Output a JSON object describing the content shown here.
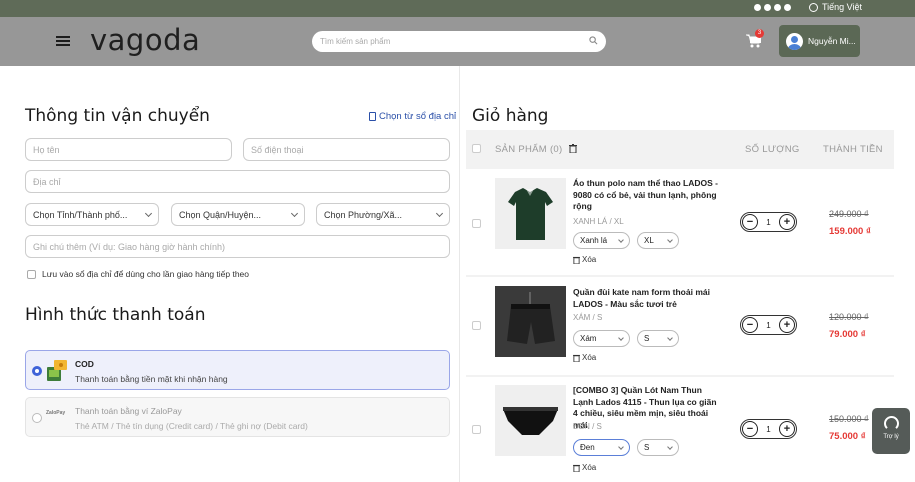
{
  "topbar": {
    "language": "Tiếng Việt",
    "social_icons": [
      "facebook-icon",
      "instagram-icon",
      "pinterest-icon",
      "youtube-icon"
    ]
  },
  "header": {
    "logo": "vagoda",
    "search_placeholder": "Tìm kiếm sản phẩm",
    "cart_count": "3",
    "user_name": "Nguyễn Mi..."
  },
  "shipping": {
    "title": "Thông tin vận chuyển",
    "address_book_link": "Chọn từ sổ địa chỉ",
    "fullname_placeholder": "Họ tên",
    "phone_placeholder": "Số điện thoại",
    "address_placeholder": "Địa chỉ",
    "province": "Chọn Tỉnh/Thành phố...",
    "district": "Chọn Quận/Huyện...",
    "ward": "Chọn Phường/Xã...",
    "note_placeholder": "Ghi chú thêm (Ví dụ: Giao hàng giờ hành chính)",
    "save_label": "Lưu vào sổ địa chỉ để dùng cho lần giao hàng tiếp theo"
  },
  "payment": {
    "title": "Hình thức thanh toán",
    "options": [
      {
        "title": "COD",
        "subtitle": "Thanh toán bằng tiền mặt khi nhận hàng",
        "selected": true
      },
      {
        "title": "Thanh toán bằng ví ZaloPay",
        "subtitle": "Thẻ ATM / Thẻ tín dụng (Credit card) / Thẻ ghi nợ (Debit card)",
        "selected": false,
        "logo_text": "ZaloPay"
      }
    ]
  },
  "cart": {
    "title": "Giỏ hàng",
    "col_product": "SẢN PHẨM (0)",
    "col_qty": "SỐ LƯỢNG",
    "col_total": "THÀNH TIỀN",
    "delete_label": "Xóa",
    "items": [
      {
        "name": "Áo thun polo nam thể thao LADOS - 9080 có cổ bẻ, vải thun lạnh, phông rộng",
        "variant": "XANH LÁ / XL",
        "color": "Xanh lá",
        "size": "XL",
        "qty": "1",
        "old_price": "249.000 ₫",
        "price": "159.000 ₫"
      },
      {
        "name": "Quần đùi kate nam form thoải mái LADOS - Màu sắc tươi trẻ",
        "variant": "XÁM / S",
        "color": "Xám",
        "size": "S",
        "qty": "1",
        "old_price": "120.000 ₫",
        "price": "79.000 ₫"
      },
      {
        "name": "[COMBO 3] Quần Lót Nam Thun Lạnh Lados 4115 - Thun lụa co giãn 4 chiều, siêu mềm mịn, siêu thoái mái",
        "variant": "ĐEN / S",
        "color": "Đen",
        "size": "S",
        "qty": "1",
        "old_price": "150.000 ₫",
        "price": "75.000 ₫"
      }
    ]
  },
  "support": {
    "label": "Trợ lý"
  },
  "colors": {
    "header_bg": "#979797",
    "topbar_bg": "#5f6b58",
    "accent_blue": "#3f63d8",
    "price_red": "#e53935"
  }
}
